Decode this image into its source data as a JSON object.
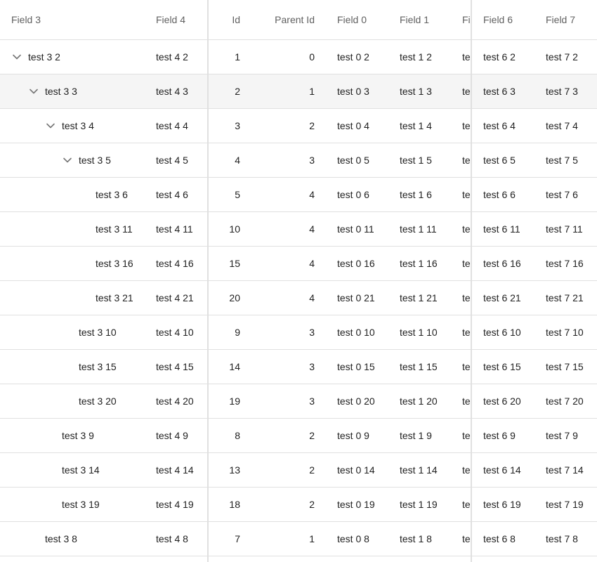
{
  "columns": {
    "field3": "Field 3",
    "field4": "Field 4",
    "id": "Id",
    "parent_id": "Parent Id",
    "field0": "Field 0",
    "field1": "Field 1",
    "field2": "Fi",
    "field6": "Field 6",
    "field7": "Field 7"
  },
  "icons": {
    "collapse": "chevron-down-icon"
  },
  "colors": {
    "header_text": "#616161",
    "selected_row": "#f5f5f5",
    "divider": "#e0e0e0"
  },
  "rows": [
    {
      "f3": "test 3 2",
      "f4": "test 4 2",
      "id": "1",
      "pid": "0",
      "f0": "test 0 2",
      "f1": "test 1 2",
      "f2": "te",
      "f6": "test 6 2",
      "f7": "test 7 2",
      "level": 0,
      "expandable": true,
      "selected": false
    },
    {
      "f3": "test 3 3",
      "f4": "test 4 3",
      "id": "2",
      "pid": "1",
      "f0": "test 0 3",
      "f1": "test 1 3",
      "f2": "te",
      "f6": "test 6 3",
      "f7": "test 7 3",
      "level": 1,
      "expandable": true,
      "selected": true
    },
    {
      "f3": "test 3 4",
      "f4": "test 4 4",
      "id": "3",
      "pid": "2",
      "f0": "test 0 4",
      "f1": "test 1 4",
      "f2": "te",
      "f6": "test 6 4",
      "f7": "test 7 4",
      "level": 2,
      "expandable": true,
      "selected": false
    },
    {
      "f3": "test 3 5",
      "f4": "test 4 5",
      "id": "4",
      "pid": "3",
      "f0": "test 0 5",
      "f1": "test 1 5",
      "f2": "te",
      "f6": "test 6 5",
      "f7": "test 7 5",
      "level": 3,
      "expandable": true,
      "selected": false
    },
    {
      "f3": "test 3 6",
      "f4": "test 4 6",
      "id": "5",
      "pid": "4",
      "f0": "test 0 6",
      "f1": "test 1 6",
      "f2": "te",
      "f6": "test 6 6",
      "f7": "test 7 6",
      "level": 4,
      "expandable": false,
      "selected": false
    },
    {
      "f3": "test 3 11",
      "f4": "test 4 11",
      "id": "10",
      "pid": "4",
      "f0": "test 0 11",
      "f1": "test 1 11",
      "f2": "te",
      "f6": "test 6 11",
      "f7": "test 7 11",
      "level": 4,
      "expandable": false,
      "selected": false
    },
    {
      "f3": "test 3 16",
      "f4": "test 4 16",
      "id": "15",
      "pid": "4",
      "f0": "test 0 16",
      "f1": "test 1 16",
      "f2": "te",
      "f6": "test 6 16",
      "f7": "test 7 16",
      "level": 4,
      "expandable": false,
      "selected": false
    },
    {
      "f3": "test 3 21",
      "f4": "test 4 21",
      "id": "20",
      "pid": "4",
      "f0": "test 0 21",
      "f1": "test 1 21",
      "f2": "te",
      "f6": "test 6 21",
      "f7": "test 7 21",
      "level": 4,
      "expandable": false,
      "selected": false
    },
    {
      "f3": "test 3 10",
      "f4": "test 4 10",
      "id": "9",
      "pid": "3",
      "f0": "test 0 10",
      "f1": "test 1 10",
      "f2": "te",
      "f6": "test 6 10",
      "f7": "test 7 10",
      "level": 3,
      "expandable": false,
      "selected": false
    },
    {
      "f3": "test 3 15",
      "f4": "test 4 15",
      "id": "14",
      "pid": "3",
      "f0": "test 0 15",
      "f1": "test 1 15",
      "f2": "te",
      "f6": "test 6 15",
      "f7": "test 7 15",
      "level": 3,
      "expandable": false,
      "selected": false
    },
    {
      "f3": "test 3 20",
      "f4": "test 4 20",
      "id": "19",
      "pid": "3",
      "f0": "test 0 20",
      "f1": "test 1 20",
      "f2": "te",
      "f6": "test 6 20",
      "f7": "test 7 20",
      "level": 3,
      "expandable": false,
      "selected": false
    },
    {
      "f3": "test 3 9",
      "f4": "test 4 9",
      "id": "8",
      "pid": "2",
      "f0": "test 0 9",
      "f1": "test 1 9",
      "f2": "te",
      "f6": "test 6 9",
      "f7": "test 7 9",
      "level": 2,
      "expandable": false,
      "selected": false
    },
    {
      "f3": "test 3 14",
      "f4": "test 4 14",
      "id": "13",
      "pid": "2",
      "f0": "test 0 14",
      "f1": "test 1 14",
      "f2": "te",
      "f6": "test 6 14",
      "f7": "test 7 14",
      "level": 2,
      "expandable": false,
      "selected": false
    },
    {
      "f3": "test 3 19",
      "f4": "test 4 19",
      "id": "18",
      "pid": "2",
      "f0": "test 0 19",
      "f1": "test 1 19",
      "f2": "te",
      "f6": "test 6 19",
      "f7": "test 7 19",
      "level": 2,
      "expandable": false,
      "selected": false
    },
    {
      "f3": "test 3 8",
      "f4": "test 4 8",
      "id": "7",
      "pid": "1",
      "f0": "test 0 8",
      "f1": "test 1 8",
      "f2": "te",
      "f6": "test 6 8",
      "f7": "test 7 8",
      "level": 1,
      "expandable": false,
      "selected": false
    }
  ]
}
